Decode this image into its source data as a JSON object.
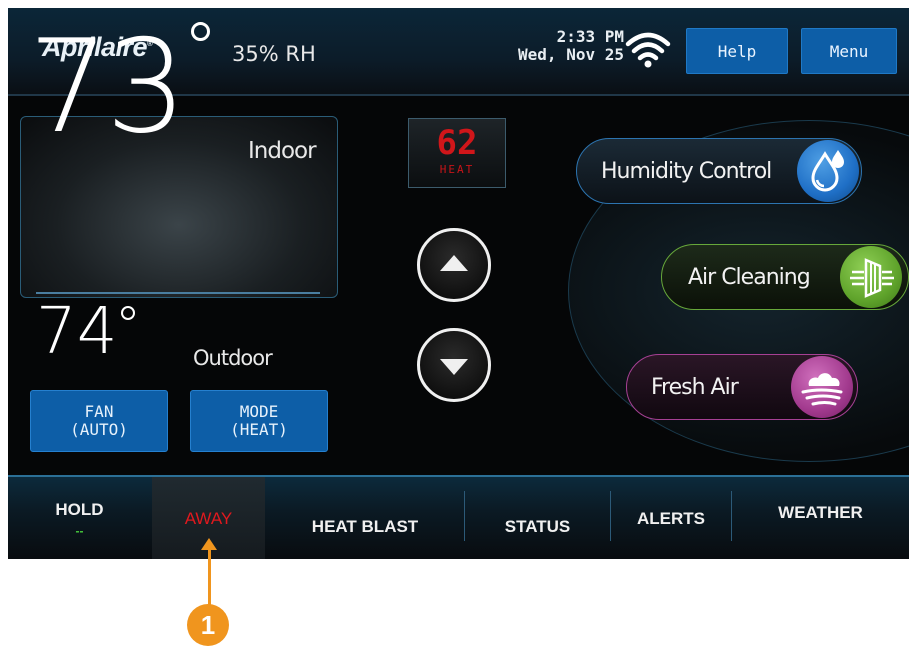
{
  "header": {
    "logo": "Aprilaire",
    "time": "2:33 PM",
    "date": "Wed, Nov 25",
    "help_label": "Help",
    "menu_label": "Menu"
  },
  "indoor": {
    "temperature": "73",
    "humidity": "35% RH",
    "label": "Indoor"
  },
  "outdoor": {
    "temperature": "74",
    "label": "Outdoor"
  },
  "controls": {
    "fan_label": "FAN",
    "fan_value": "(AUTO)",
    "mode_label": "MODE",
    "mode_value": "(HEAT)"
  },
  "setpoint": {
    "value": "62",
    "mode": "HEAT"
  },
  "features": {
    "humidity": "Humidity Control",
    "air_cleaning": "Air Cleaning",
    "fresh_air": "Fresh Air"
  },
  "bottom_nav": {
    "hold": "HOLD",
    "hold_status": "--",
    "away": "AWAY",
    "heat_blast": "HEAT BLAST",
    "status": "STATUS",
    "alerts": "ALERTS",
    "weather": "WEATHER"
  },
  "annotation": {
    "badge": "1"
  },
  "colors": {
    "button_blue": "#0d5ea7",
    "setpoint_red": "#d0161a",
    "away_red": "#e0191e",
    "callout_orange": "#f0951e",
    "humidity_blue": "#1f6fc6",
    "air_cleaning_green": "#5fa32b",
    "fresh_air_purple": "#a23a8e"
  },
  "icons": {
    "wifi": "wifi-icon",
    "up": "arrow-up-icon",
    "down": "arrow-down-icon",
    "humidity": "water-drops-icon",
    "air_cleaning": "air-filter-icon",
    "fresh_air": "cloud-wind-icon"
  }
}
